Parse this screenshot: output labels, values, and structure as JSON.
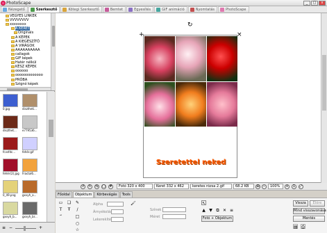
{
  "window": {
    "title": "PhotoScape",
    "buttons": [
      "_",
      "□",
      "x"
    ]
  },
  "tabs": [
    {
      "label": "Nézegető",
      "active": false,
      "icon": "viewer-icon",
      "color": "#6aa8e0"
    },
    {
      "label": "Szerkesztő",
      "active": true,
      "icon": "editor-icon",
      "color": "#4d9a4d"
    },
    {
      "label": "Kötegi Szerkesztő",
      "active": false,
      "icon": "batch-editor-icon",
      "color": "#d9a43a"
    },
    {
      "label": "Bemtet",
      "active": false,
      "icon": "page-icon",
      "color": "#c75b9b"
    },
    {
      "label": "Egyesítés",
      "active": false,
      "icon": "combine-icon",
      "color": "#8a70c4"
    },
    {
      "label": "GIF animáció",
      "active": false,
      "icon": "gif-icon",
      "color": "#46a7a0"
    },
    {
      "label": "Nyomtatás",
      "active": false,
      "icon": "print-icon",
      "color": "#c45050"
    },
    {
      "label": "PhotoScape",
      "active": false,
      "icon": "photoscape-icon",
      "color": "#e07ab0"
    }
  ],
  "tree": {
    "items": [
      {
        "label": "VEGYES LINKEK",
        "indent": 2
      },
      {
        "label": "VVVVVVVV",
        "indent": 2
      },
      {
        "label": "xxxxxxxx",
        "indent": 2
      },
      {
        "label": "A KERET",
        "indent": 4,
        "selected": true
      },
      {
        "label": "Originals",
        "indent": 5
      },
      {
        "label": "A KÉPEK",
        "indent": 4
      },
      {
        "label": "A KIEGÉSZÍTŐ",
        "indent": 4
      },
      {
        "label": "A VIRÁGOK",
        "indent": 4
      },
      {
        "label": "AAAAAAAAAA",
        "indent": 4
      },
      {
        "label": "callagok",
        "indent": 4
      },
      {
        "label": "GIF képek",
        "indent": 4
      },
      {
        "label": "Hatér nélkül",
        "indent": 4
      },
      {
        "label": "KÉSZ KÉPEK",
        "indent": 4
      },
      {
        "label": "oooooo",
        "indent": 4
      },
      {
        "label": "ooooooooooooo",
        "indent": 4
      },
      {
        "label": "PRÓBA",
        "indent": 4
      },
      {
        "label": "Szignó képek",
        "indent": 4
      }
    ]
  },
  "thumbnails": [
    {
      "caption": "0.jpg",
      "color": "#3d5fd0"
    },
    {
      "caption": "disztheti...",
      "color": "#b08f6a"
    },
    {
      "caption": "diszthet...",
      "color": "#6c2a18"
    },
    {
      "caption": "e779536...",
      "color": "#c8c8c8"
    },
    {
      "caption": "fcvsfdc...",
      "color": "#9b1a1a"
    },
    {
      "caption": "fehér.gif",
      "color": "#d0d0ff"
    },
    {
      "caption": "fehér(2).jpg",
      "color": "#a10f2a"
    },
    {
      "caption": "Fractal6...",
      "color": "#f2a23c"
    },
    {
      "caption": "0_49.png",
      "color": "#e4d27a"
    },
    {
      "caption": "gxvyh_a...",
      "color": "#b96a2a"
    },
    {
      "caption": "gxvyh_b...",
      "color": "#d9d9a0"
    },
    {
      "caption": "gxvyh_br...",
      "color": "#6a6a6a"
    }
  ],
  "photo": {
    "caption": "Szeretettel neked"
  },
  "status": {
    "size": "Fotó 320 x 400",
    "frame": "Keret 332 x 462",
    "file": "keretes rózsa 2.gif",
    "filesize": "68.2 KB",
    "zoom": "100%"
  },
  "panel_tabs": [
    {
      "label": "Főoldal",
      "active": false
    },
    {
      "label": "Objektum",
      "active": true
    },
    {
      "label": "Körbevágás",
      "active": false
    },
    {
      "label": "Tools",
      "active": false
    }
  ],
  "panel": {
    "alpha_label": "Alpha",
    "shadow_label": "Árnyékolás",
    "line_label": "Lekerekítés",
    "color_label": "Színek",
    "size_label": "Méret",
    "photo_obj_button": "Fotó + Objektum",
    "undo_button": "Vissza",
    "redo_button": "Előre",
    "undo_all_button": "Mind visszavonása",
    "save_button": "Mentés"
  }
}
